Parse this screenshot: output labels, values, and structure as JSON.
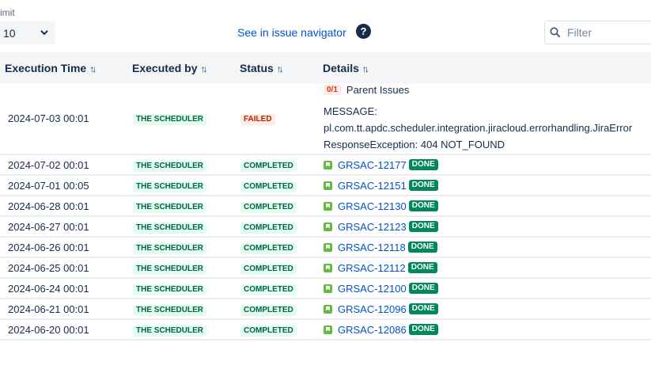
{
  "controls": {
    "limit_label": "imit",
    "limit_value": "10",
    "nav_link": "See in issue navigator",
    "help_symbol": "?",
    "filter_placeholder": "Filter"
  },
  "table": {
    "headers": [
      "Execution Time",
      "Executed by",
      "Status",
      "Details"
    ],
    "failed_row": {
      "time": "2024-07-03 00:01",
      "executor": "THE SCHEDULER",
      "status": "FAILED",
      "count": "0/1",
      "parent_label": "Parent Issues",
      "message_label": "MESSAGE:",
      "message_line1": "pl.com.tt.apdc.scheduler.integration.jiracloud.errorhandling.JiraError",
      "message_line2": "ResponseException: 404 NOT_FOUND"
    },
    "rows": [
      {
        "time": "2024-07-02 00:01",
        "executor": "THE SCHEDULER",
        "status": "COMPLETED",
        "issue": "GRSAC-12177",
        "issue_status": "DONE"
      },
      {
        "time": "2024-07-01 00:05",
        "executor": "THE SCHEDULER",
        "status": "COMPLETED",
        "issue": "GRSAC-12151",
        "issue_status": "DONE"
      },
      {
        "time": "2024-06-28 00:01",
        "executor": "THE SCHEDULER",
        "status": "COMPLETED",
        "issue": "GRSAC-12130",
        "issue_status": "DONE"
      },
      {
        "time": "2024-06-27 00:01",
        "executor": "THE SCHEDULER",
        "status": "COMPLETED",
        "issue": "GRSAC-12123",
        "issue_status": "DONE"
      },
      {
        "time": "2024-06-26 00:01",
        "executor": "THE SCHEDULER",
        "status": "COMPLETED",
        "issue": "GRSAC-12118",
        "issue_status": "DONE"
      },
      {
        "time": "2024-06-25 00:01",
        "executor": "THE SCHEDULER",
        "status": "COMPLETED",
        "issue": "GRSAC-12112",
        "issue_status": "DONE"
      },
      {
        "time": "2024-06-24 00:01",
        "executor": "THE SCHEDULER",
        "status": "COMPLETED",
        "issue": "GRSAC-12100",
        "issue_status": "DONE"
      },
      {
        "time": "2024-06-21 00:01",
        "executor": "THE SCHEDULER",
        "status": "COMPLETED",
        "issue": "GRSAC-12096",
        "issue_status": "DONE"
      },
      {
        "time": "2024-06-20 00:01",
        "executor": "THE SCHEDULER",
        "status": "COMPLETED",
        "issue": "GRSAC-12086",
        "issue_status": "DONE"
      }
    ]
  },
  "icons": {
    "sort": "sort-arrows-icon",
    "issue_type": "story-icon",
    "search": "search-icon",
    "dropdown": "chevron-down-icon",
    "help": "help-icon"
  },
  "colors": {
    "link": "#0052cc",
    "completed_bg": "#e3fcef",
    "completed_text": "#006644",
    "failed_bg": "#ffebe6",
    "failed_text": "#bf2600",
    "done_bg": "#00875a",
    "story": "#63ba3c"
  }
}
